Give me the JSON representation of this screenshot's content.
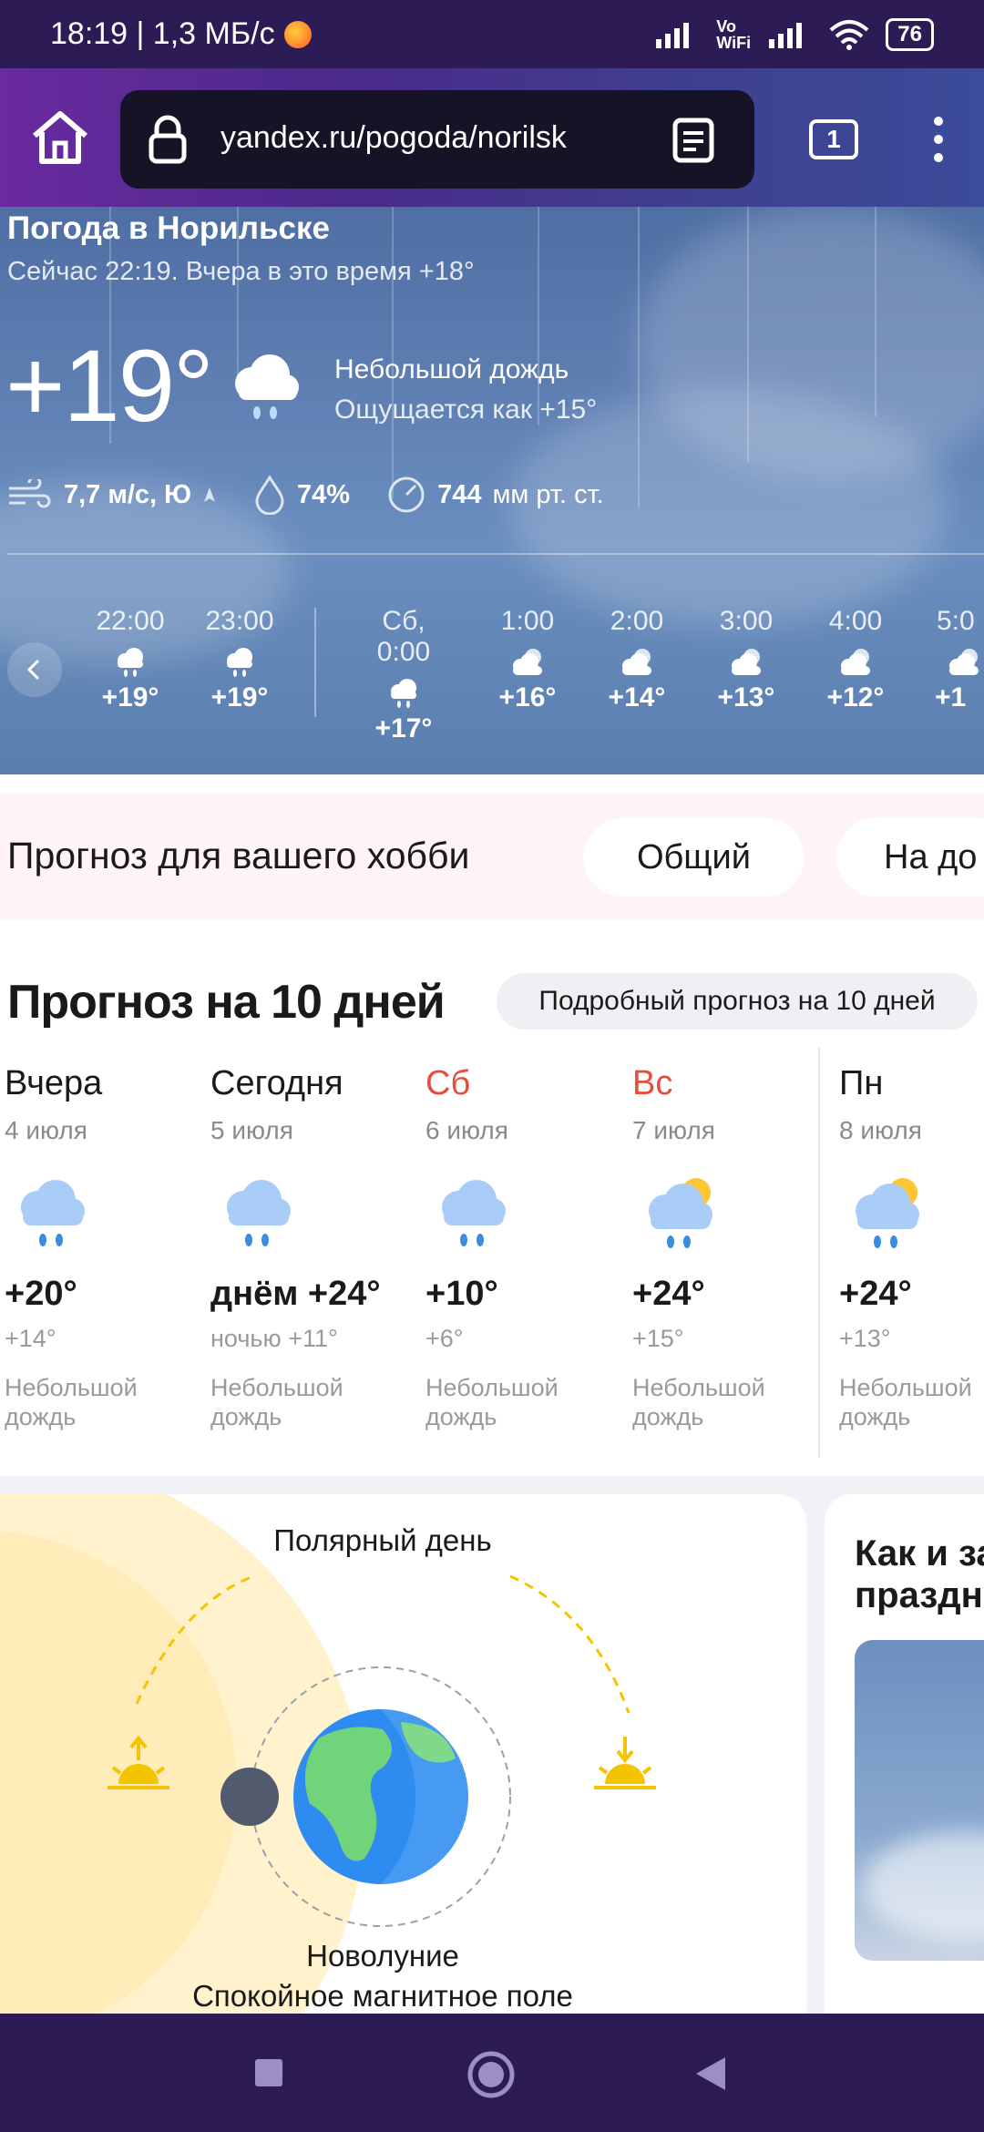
{
  "status_bar": {
    "time_speed": "18:19 | 1,3 МБ/с",
    "network_label": "Vo WiFi",
    "battery": "76"
  },
  "browser": {
    "url": "yandex.ru/pogoda/norilsk",
    "tab_count": "1"
  },
  "current": {
    "title": "Погода в Норильске",
    "subtitle": "Сейчас 22:19. Вчера в это время +18°",
    "temperature": "+19°",
    "condition": "Небольшой дождь",
    "feels_like": "Ощущается как +15°",
    "wind": "7,7 м/с, Ю",
    "humidity": "74%",
    "pressure_value": "744",
    "pressure_unit": "мм рт. ст."
  },
  "hourly": [
    {
      "time": "22:00",
      "temp": "+19°",
      "icon": "rain-cloud-icon"
    },
    {
      "time": "23:00",
      "temp": "+19°",
      "icon": "rain-cloud-icon"
    },
    {
      "time": "Сб, 0:00",
      "temp": "+17°",
      "icon": "rain-cloud-icon"
    },
    {
      "time": "1:00",
      "temp": "+16°",
      "icon": "cloudy-icon"
    },
    {
      "time": "2:00",
      "temp": "+14°",
      "icon": "cloudy-icon"
    },
    {
      "time": "3:00",
      "temp": "+13°",
      "icon": "cloudy-icon"
    },
    {
      "time": "4:00",
      "temp": "+12°",
      "icon": "cloudy-icon"
    },
    {
      "time": "5:0",
      "temp": "+1",
      "icon": "cloudy-icon"
    }
  ],
  "hobby": {
    "title": "Прогноз для вашего хобби",
    "chips": [
      "Общий",
      "На до"
    ]
  },
  "forecast": {
    "title": "Прогноз на 10 дней",
    "detail_button": "Подробный прогноз на 10 дней",
    "days": [
      {
        "name": "Вчера",
        "date": "4 июля",
        "high": "+20°",
        "low": "+14°",
        "cond1": "Небольшой",
        "cond2": "дождь",
        "weekend": false,
        "icon": "rain-cloud-icon"
      },
      {
        "name": "Сегодня",
        "date": "5 июля",
        "high": "днём +24°",
        "low": "ночью +11°",
        "cond1": "Небольшой",
        "cond2": "дождь",
        "weekend": false,
        "icon": "rain-cloud-icon"
      },
      {
        "name": "Сб",
        "date": "6 июля",
        "high": "+10°",
        "low": "+6°",
        "cond1": "Небольшой",
        "cond2": "дождь",
        "weekend": true,
        "icon": "rain-cloud-icon"
      },
      {
        "name": "Вс",
        "date": "7 июля",
        "high": "+24°",
        "low": "+15°",
        "cond1": "Небольшой",
        "cond2": "дождь",
        "weekend": true,
        "icon": "sun-rain-cloud-icon"
      },
      {
        "name": "Пн",
        "date": "8 июля",
        "high": "+24°",
        "low": "+13°",
        "cond1": "Небольшой",
        "cond2": "дождь",
        "weekend": false,
        "icon": "sun-rain-cloud-icon"
      }
    ]
  },
  "polar": {
    "title": "Полярный день",
    "moon": "Новолуние",
    "magnetic": "Спокойное магнитное поле"
  },
  "holiday": {
    "title_line1": "Как и за",
    "title_line2": "праздн"
  },
  "colors": {
    "accent_red": "#e54e3d",
    "sun": "#f5c400",
    "night_bar": "#2d1b55"
  }
}
